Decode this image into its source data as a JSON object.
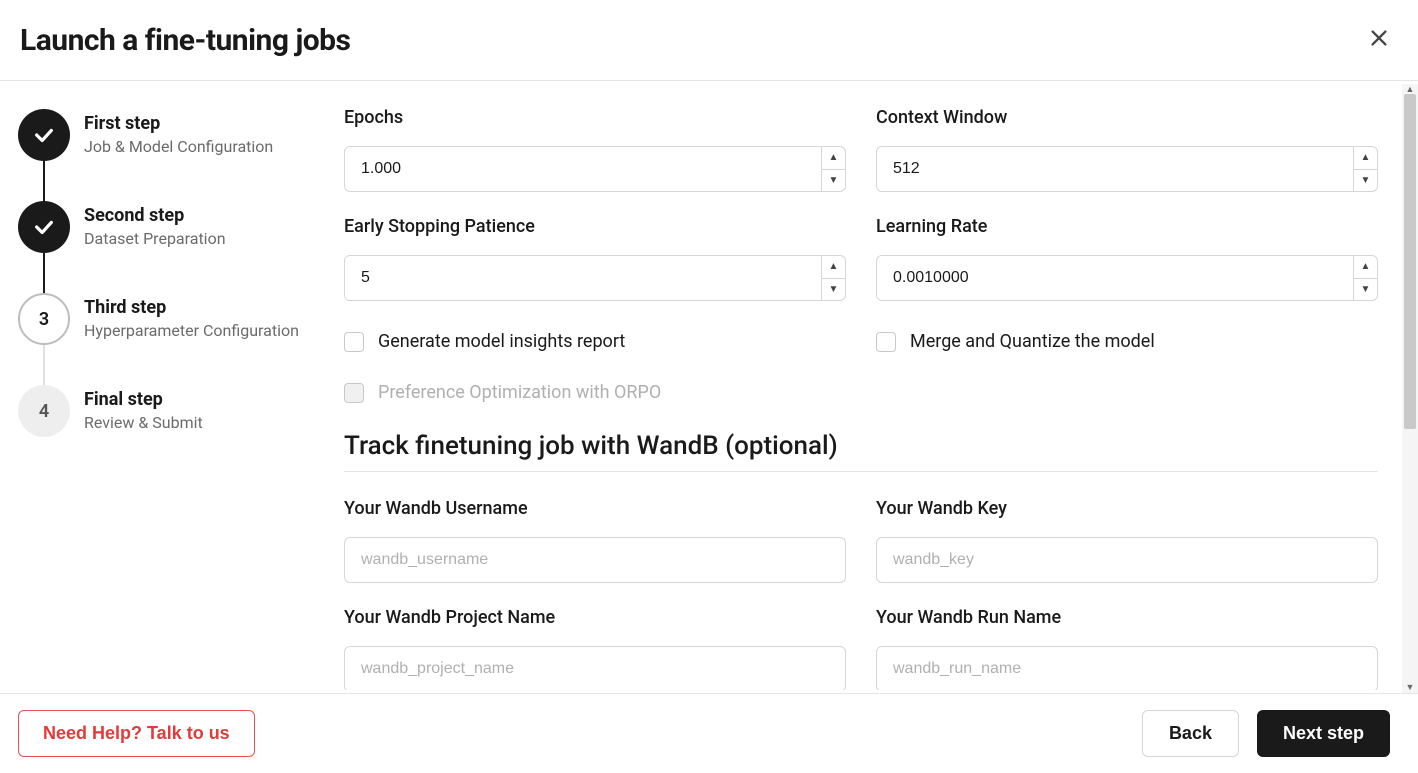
{
  "header": {
    "title": "Launch a fine-tuning jobs"
  },
  "steps": [
    {
      "title": "First step",
      "sub": "Job & Model Configuration",
      "state": "done"
    },
    {
      "title": "Second step",
      "sub": "Dataset Preparation",
      "state": "done"
    },
    {
      "title": "Third step",
      "sub": "Hyperparameter Configuration",
      "state": "active",
      "num": "3"
    },
    {
      "title": "Final step",
      "sub": "Review & Submit",
      "state": "pending",
      "num": "4"
    }
  ],
  "fields": {
    "epochs": {
      "label": "Epochs",
      "value": "1.000"
    },
    "context_window": {
      "label": "Context Window",
      "value": "512"
    },
    "early_stopping": {
      "label": "Early Stopping Patience",
      "value": "5"
    },
    "learning_rate": {
      "label": "Learning Rate",
      "value": "0.0010000"
    }
  },
  "checks": {
    "insights": {
      "label": "Generate model insights report"
    },
    "merge": {
      "label": "Merge and Quantize the model"
    },
    "orpo": {
      "label": "Preference Optimization with ORPO",
      "disabled": true
    }
  },
  "wandb": {
    "section_title": "Track finetuning job with WandB (optional)",
    "username": {
      "label": "Your Wandb Username",
      "placeholder": "wandb_username"
    },
    "key": {
      "label": "Your Wandb Key",
      "placeholder": "wandb_key"
    },
    "project": {
      "label": "Your Wandb Project Name",
      "placeholder": "wandb_project_name"
    },
    "run": {
      "label": "Your Wandb Run Name",
      "placeholder": "wandb_run_name"
    }
  },
  "footer": {
    "help": "Need Help? Talk to us",
    "back": "Back",
    "next": "Next step"
  }
}
